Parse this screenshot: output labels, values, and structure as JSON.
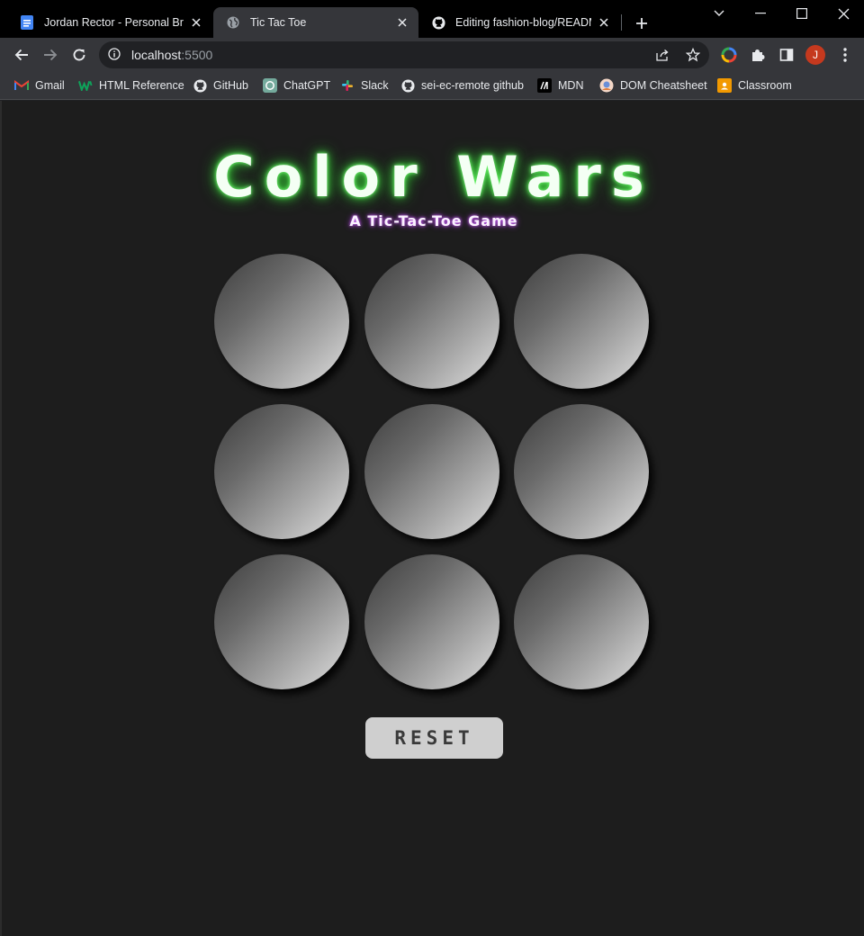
{
  "browser": {
    "tabs": [
      {
        "title": "Jordan Rector - Personal Brand",
        "icon": "google-docs-icon",
        "active": false
      },
      {
        "title": "Tic Tac Toe",
        "icon": "globe-icon",
        "active": true
      },
      {
        "title": "Editing fashion-blog/README.md",
        "icon": "github-icon",
        "active": false
      }
    ],
    "address": {
      "host": "localhost",
      "port": ":5500"
    },
    "profile_initial": "J",
    "bookmarks": [
      {
        "label": "Gmail",
        "icon": "gmail-icon"
      },
      {
        "label": "HTML Reference",
        "icon": "html-reference-icon"
      },
      {
        "label": "GitHub",
        "icon": "github-icon"
      },
      {
        "label": "ChatGPT",
        "icon": "chatgpt-icon"
      },
      {
        "label": "Slack",
        "icon": "slack-icon"
      },
      {
        "label": "sei-ec-remote github",
        "icon": "github-icon"
      },
      {
        "label": "MDN",
        "icon": "mdn-icon"
      },
      {
        "label": "DOM Cheatsheet",
        "icon": "cheatsheet-icon"
      },
      {
        "label": "Classroom",
        "icon": "classroom-icon"
      }
    ]
  },
  "game": {
    "title": "Color Wars",
    "subtitle": "A Tic-Tac-Toe Game",
    "cells": [
      "",
      "",
      "",
      "",
      "",
      "",
      "",
      "",
      ""
    ],
    "reset_label": "RESET"
  },
  "colors": {
    "title_glow": "#3fd63f",
    "subtitle_glow": "#a335d9",
    "page_background": "#1d1d1d",
    "reset_button": "#cfcfcf"
  }
}
